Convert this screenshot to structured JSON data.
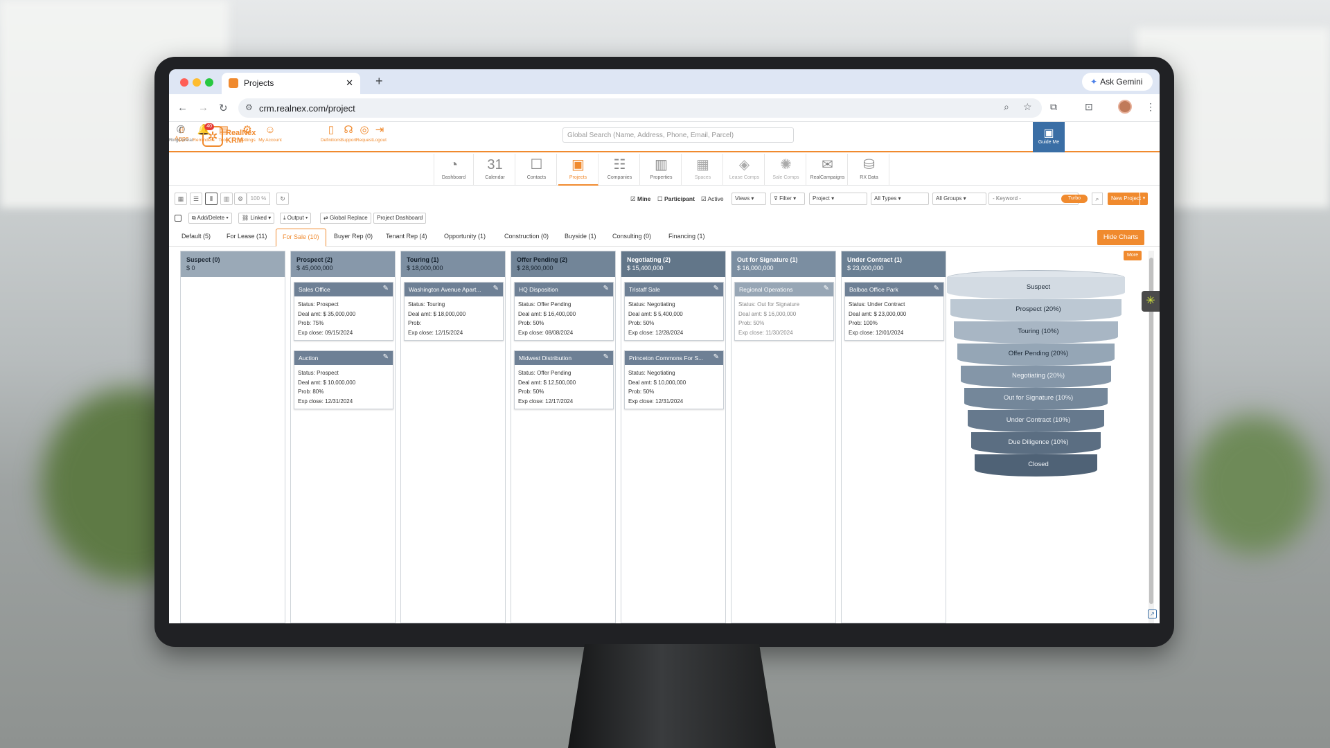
{
  "browser": {
    "tab_title": "Projects",
    "url": "crm.realnex.com/project",
    "gemini": "Ask Gemini"
  },
  "app": {
    "apps_label": "Apps",
    "logo_line1": "RealNex",
    "logo_line2": "KRM",
    "search_placeholder": "Global Search (Name, Address, Phone, Email, Parcel)"
  },
  "header_icons": [
    {
      "label": "RingCentral",
      "icon": "phone-icon",
      "glyph": "✆"
    },
    {
      "label": "Reminders",
      "icon": "bell-icon",
      "glyph": "🔔",
      "badge": "40"
    },
    {
      "label": "Tools",
      "icon": "tools-icon",
      "glyph": "▤"
    },
    {
      "label": "Settings",
      "icon": "gear-icon",
      "glyph": "⚙"
    },
    {
      "label": "My Account",
      "icon": "account-icon",
      "glyph": "☺"
    },
    {
      "label": "Guide Me",
      "icon": "guide-icon",
      "glyph": "▣"
    },
    {
      "label": "Definitions",
      "icon": "book-icon",
      "glyph": "▯"
    },
    {
      "label": "Support",
      "icon": "headset-icon",
      "glyph": "☊"
    },
    {
      "label": "Request",
      "icon": "bulb-icon",
      "glyph": "◎"
    },
    {
      "label": "Logout",
      "icon": "logout-icon",
      "glyph": "⇥"
    }
  ],
  "modules": [
    {
      "label": "Dashboard",
      "icon": "dashboard-icon",
      "glyph": "◔"
    },
    {
      "label": "Calendar",
      "icon": "calendar-icon",
      "glyph": "31"
    },
    {
      "label": "Contacts",
      "icon": "contacts-icon",
      "glyph": "☐"
    },
    {
      "label": "Projects",
      "icon": "projects-icon",
      "glyph": "▣",
      "active": true
    },
    {
      "label": "Companies",
      "icon": "companies-icon",
      "glyph": "☷"
    },
    {
      "label": "Properties",
      "icon": "properties-icon",
      "glyph": "▥"
    },
    {
      "label": "Spaces",
      "icon": "spaces-icon",
      "glyph": "▦"
    },
    {
      "label": "Lease Comps",
      "icon": "lease-comps-icon",
      "glyph": "◈"
    },
    {
      "label": "Sale Comps",
      "icon": "sale-comps-icon",
      "glyph": "✺"
    },
    {
      "label": "RealCampaigns",
      "icon": "campaigns-icon",
      "glyph": "✉"
    },
    {
      "label": "RX Data",
      "icon": "rx-data-icon",
      "glyph": "⛁"
    }
  ],
  "toolbar": {
    "zoom": "100 %",
    "mine": "Mine",
    "participant": "Participant",
    "active": "Active",
    "views": "Views",
    "filter": "Filter",
    "project": "Project",
    "all_types": "All Types",
    "all_groups": "All Groups",
    "keyword": "- Keyword -",
    "turbo": "Turbo",
    "new_project": "New Project"
  },
  "toolbar2": {
    "add_delete": "Add/Delete",
    "linked": "Linked",
    "output": "Output",
    "global_replace": "Global Replace",
    "project_dashboard": "Project Dashboard"
  },
  "tabs": [
    "Default (5)",
    "For Lease (11)",
    "For Sale (10)",
    "Buyer Rep (0)",
    "Tenant Rep (4)",
    "Opportunity (1)",
    "Construction (0)",
    "Buyside (1)",
    "Consulting (0)",
    "Financing (1)"
  ],
  "hide_charts": "Hide Charts",
  "more": "More",
  "columns": [
    {
      "title": "Suspect (0)",
      "total": "$ 0",
      "cards": []
    },
    {
      "title": "Prospect (2)",
      "total": "$ 45,000,000",
      "cards": [
        {
          "name": "Sales Office",
          "status": "Status: Prospect",
          "deal": "Deal amt: $ 35,000,000",
          "prob": "Prob: 75%",
          "close": "Exp close: 09/15/2024"
        },
        {
          "name": "Auction",
          "status": "Status: Prospect",
          "deal": "Deal amt: $ 10,000,000",
          "prob": "Prob: 80%",
          "close": "Exp close: 12/31/2024"
        }
      ]
    },
    {
      "title": "Touring (1)",
      "total": "$ 18,000,000",
      "cards": [
        {
          "name": "Washington Avenue Apart...",
          "status": "Status: Touring",
          "deal": "Deal amt: $ 18,000,000",
          "prob": "Prob:",
          "close": "Exp close: 12/15/2024"
        }
      ]
    },
    {
      "title": "Offer Pending (2)",
      "total": "$ 28,900,000",
      "cards": [
        {
          "name": "HQ Disposition",
          "status": "Status: Offer Pending",
          "deal": "Deal amt: $ 16,400,000",
          "prob": "Prob: 50%",
          "close": "Exp close: 08/08/2024"
        },
        {
          "name": "Midwest Distribution",
          "status": "Status: Offer Pending",
          "deal": "Deal amt: $ 12,500,000",
          "prob": "Prob: 50%",
          "close": "Exp close: 12/17/2024"
        }
      ]
    },
    {
      "title": "Negotiating (2)",
      "total": "$ 15,400,000",
      "cards": [
        {
          "name": "Tristaff Sale",
          "status": "Status: Negotiating",
          "deal": "Deal amt: $ 5,400,000",
          "prob": "Prob: 50%",
          "close": "Exp close: 12/28/2024"
        },
        {
          "name": "Princeton Commons For S...",
          "status": "Status: Negotiating",
          "deal": "Deal amt: $ 10,000,000",
          "prob": "Prob: 50%",
          "close": "Exp close: 12/31/2024"
        }
      ]
    },
    {
      "title": "Out for Signature (1)",
      "total": "$ 16,000,000",
      "cards": [
        {
          "name": "Regional Operations",
          "status": "Status: Out for Signature",
          "deal": "Deal amt: $ 16,000,000",
          "prob": "Prob: 50%",
          "close": "Exp close: 11/30/2024"
        }
      ]
    },
    {
      "title": "Under Contract (1)",
      "total": "$ 23,000,000",
      "cards": [
        {
          "name": "Balboa Office Park",
          "status": "Status: Under Contract",
          "deal": "Deal amt: $ 23,000,000",
          "prob": "Prob: 100%",
          "close": "Exp close: 12/01/2024"
        }
      ]
    }
  ],
  "chart_data": {
    "type": "funnel",
    "stages": [
      "Suspect",
      "Prospect (20%)",
      "Touring (10%)",
      "Offer Pending (20%)",
      "Negotiating (20%)",
      "Out for Signature (10%)",
      "Under Contract (10%)",
      "Due Diligence (10%)",
      "Closed"
    ],
    "colors": [
      "#d3dbe3",
      "#bcc8d3",
      "#a8b6c4",
      "#95a6b6",
      "#8496a8",
      "#74879a",
      "#66798d",
      "#5b6e82",
      "#4f6276"
    ]
  }
}
